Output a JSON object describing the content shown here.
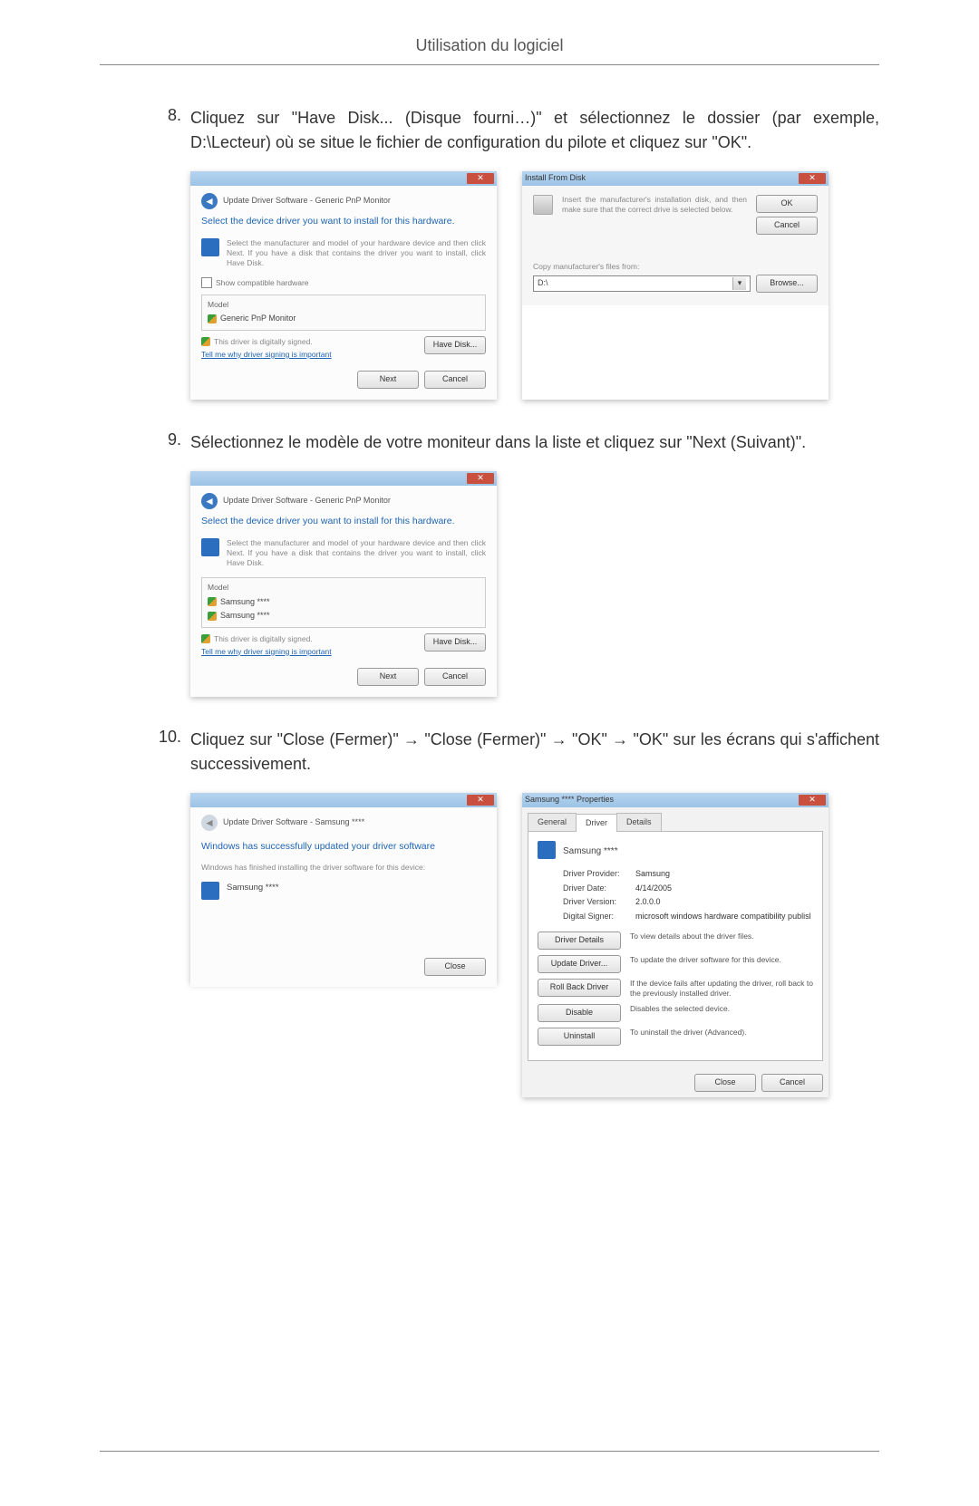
{
  "page_header": "Utilisation du logiciel",
  "steps": {
    "s8": {
      "num": "8.",
      "text": "Cliquez sur \"Have Disk... (Disque fourni…)\" et sélectionnez le dossier (par exemple, D:\\Lecteur) où se situe le fichier de configuration du pilote et cliquez sur \"OK\"."
    },
    "s9": {
      "num": "9.",
      "text": "Sélectionnez le modèle de votre moniteur dans la liste et cliquez sur \"Next (Suivant)\"."
    },
    "s10": {
      "num": "10.",
      "text": "Cliquez sur \"Close (Fermer)\" → \"Close (Fermer)\" → \"OK\" → \"OK\" sur les écrans qui s'affichent successivement."
    }
  },
  "dlg8a": {
    "breadcrumb": "Update Driver Software - Generic PnP Monitor",
    "heading": "Select the device driver you want to install for this hardware.",
    "note": "Select the manufacturer and model of your hardware device and then click Next. If you have a disk that contains the driver you want to install, click Have Disk.",
    "show_compat": "Show compatible hardware",
    "model_label": "Model",
    "model_item": "Generic PnP Monitor",
    "signed_text": "This driver is digitally signed.",
    "signed_link": "Tell me why driver signing is important",
    "have_disk_btn": "Have Disk...",
    "next_btn": "Next",
    "cancel_btn": "Cancel"
  },
  "dlg8b": {
    "title": "Install From Disk",
    "instr": "Insert the manufacturer's installation disk, and then make sure that the correct drive is selected below.",
    "ok_btn": "OK",
    "cancel_btn": "Cancel",
    "copy_label": "Copy manufacturer's files from:",
    "path": "D:\\",
    "browse_btn": "Browse..."
  },
  "dlg9": {
    "breadcrumb": "Update Driver Software - Generic PnP Monitor",
    "heading": "Select the device driver you want to install for this hardware.",
    "note": "Select the manufacturer and model of your hardware device and then click Next. If you have a disk that contains the driver you want to install, click Have Disk.",
    "model_label": "Model",
    "model_item1": "Samsung ****",
    "model_item2": "Samsung ****",
    "signed_text": "This driver is digitally signed.",
    "signed_link": "Tell me why driver signing is important",
    "have_disk_btn": "Have Disk...",
    "next_btn": "Next",
    "cancel_btn": "Cancel"
  },
  "dlg10a": {
    "breadcrumb": "Update Driver Software - Samsung ****",
    "heading": "Windows has successfully updated your driver software",
    "sub": "Windows has finished installing the driver software for this device:",
    "device": "Samsung ****",
    "close_btn": "Close"
  },
  "dlg10b": {
    "title": "Samsung **** Properties",
    "tab_general": "General",
    "tab_driver": "Driver",
    "tab_details": "Details",
    "device_name": "Samsung ****",
    "provider_k": "Driver Provider:",
    "provider_v": "Samsung",
    "date_k": "Driver Date:",
    "date_v": "4/14/2005",
    "version_k": "Driver Version:",
    "version_v": "2.0.0.0",
    "signer_k": "Digital Signer:",
    "signer_v": "microsoft windows hardware compatibility publisl",
    "b_details": "Driver Details",
    "d_details": "To view details about the driver files.",
    "b_update": "Update Driver...",
    "d_update": "To update the driver software for this device.",
    "b_rollback": "Roll Back Driver",
    "d_rollback": "If the device fails after updating the driver, roll back to the previously installed driver.",
    "b_disable": "Disable",
    "d_disable": "Disables the selected device.",
    "b_uninstall": "Uninstall",
    "d_uninstall": "To uninstall the driver (Advanced).",
    "close_btn": "Close",
    "cancel_btn": "Cancel"
  }
}
